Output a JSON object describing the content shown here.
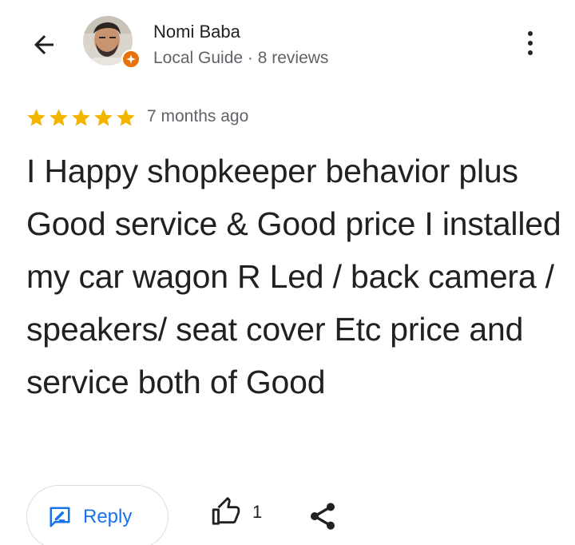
{
  "author": {
    "name": "Nomi Baba",
    "meta": "Local Guide · 8 reviews"
  },
  "review": {
    "rating": 5,
    "date": "7 months ago",
    "text": "I Happy shopkeeper behavior plus Good service & Good price I installed my car wagon R Led / back camera / speakers/ seat cover Etc price and service both of Good"
  },
  "actions": {
    "reply_label": "Reply",
    "like_count": "1"
  },
  "colors": {
    "star": "#f4b400",
    "accent": "#1a73e8",
    "guide_badge": "#e8710a"
  },
  "icons": [
    "back-arrow-icon",
    "local-guide-badge-icon",
    "more-vert-icon",
    "star-icon",
    "reply-icon",
    "thumb-up-icon",
    "share-icon"
  ]
}
